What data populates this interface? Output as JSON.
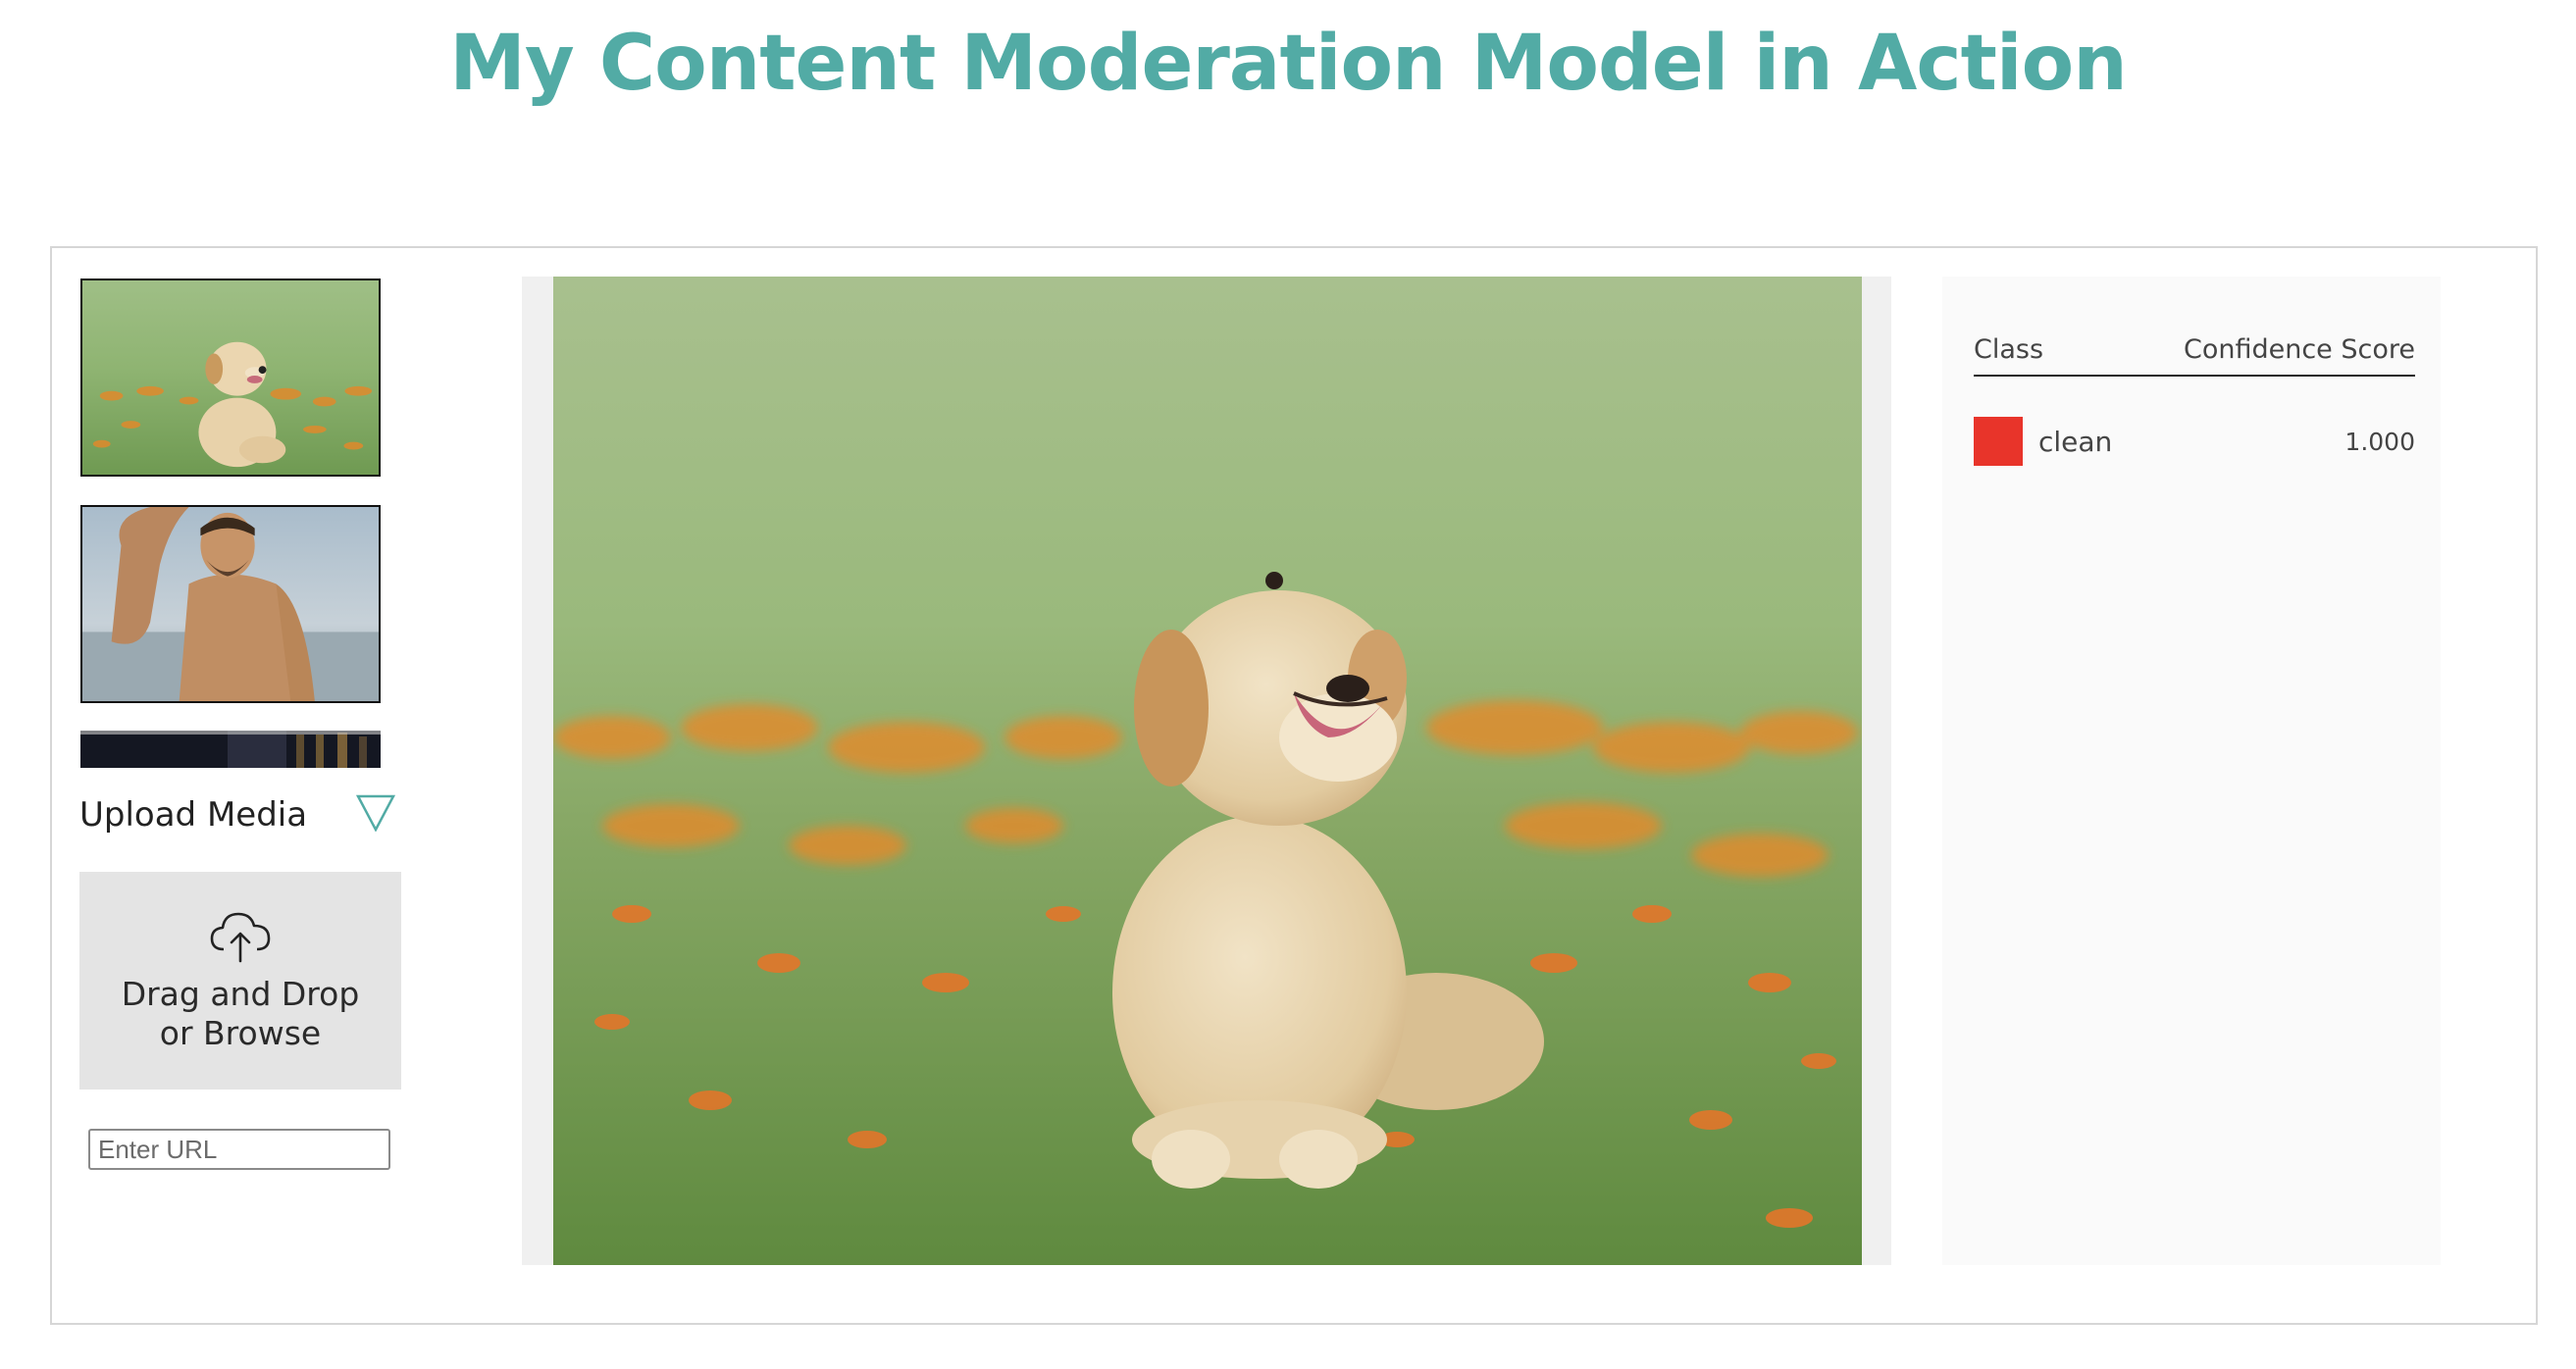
{
  "page": {
    "title": "My Content Moderation Model in Action"
  },
  "sidebar": {
    "thumbnails": [
      {
        "subject": "puppy-in-flower-field"
      },
      {
        "subject": "shirtless-man-beach"
      },
      {
        "subject": "dark-street-night"
      }
    ],
    "upload_label": "Upload Media",
    "upload_icon": "triangle-down-icon",
    "dropzone_text": "Drag and Drop or Browse",
    "dropzone_icon": "cloud-upload-icon",
    "url_placeholder": "Enter URL",
    "url_value": ""
  },
  "main": {
    "image_subject": "golden-retriever-puppy-sitting-in-grass"
  },
  "results": {
    "columns": [
      "Class",
      "Confidence Score"
    ],
    "rows": [
      {
        "label": "clean",
        "score": "1.000",
        "color": "#E8342A"
      }
    ]
  },
  "colors": {
    "accent": "#52ABA5",
    "clean_swatch": "#E8342A"
  }
}
